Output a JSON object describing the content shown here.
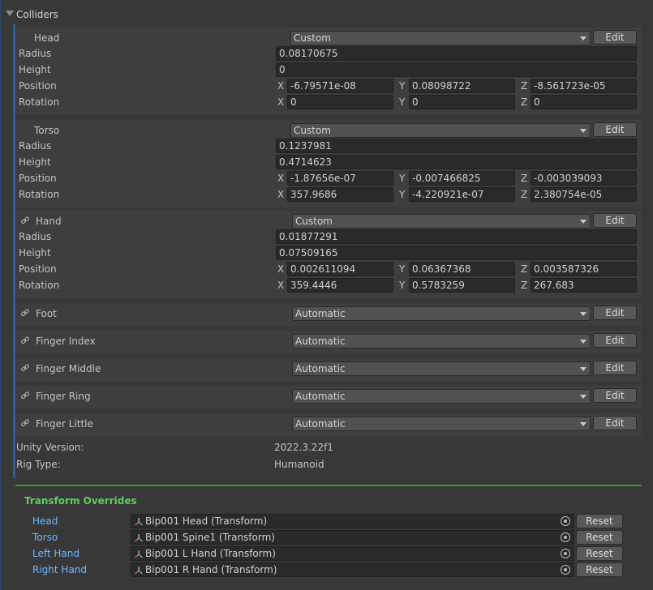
{
  "section": {
    "title": "Colliders"
  },
  "labels": {
    "radius": "Radius",
    "height": "Height",
    "position": "Position",
    "rotation": "Rotation",
    "x": "X",
    "y": "Y",
    "z": "Z",
    "edit": "Edit"
  },
  "colliders": [
    {
      "name": "Head",
      "mode": "Custom",
      "linked": false,
      "radius": "0.08170675",
      "height": "0",
      "position": [
        "-6.79571e-08",
        "0.08098722",
        "-8.561723e-05"
      ],
      "rotation": [
        "0",
        "0",
        "0"
      ]
    },
    {
      "name": "Torso",
      "mode": "Custom",
      "linked": false,
      "radius": "0.1237981",
      "height": "0.4714623",
      "position": [
        "-1.87656e-07",
        "-0.007466825",
        "-0.003039093"
      ],
      "rotation": [
        "357.9686",
        "-4.220921e-07",
        "2.380754e-05"
      ]
    },
    {
      "name": "Hand",
      "mode": "Custom",
      "linked": true,
      "radius": "0.01877291",
      "height": "0.07509165",
      "position": [
        "0.002611094",
        "0.06367368",
        "0.003587326"
      ],
      "rotation": [
        "359.4446",
        "0.5783259",
        "267.683"
      ]
    },
    {
      "name": "Foot",
      "mode": "Automatic",
      "linked": true
    },
    {
      "name": "Finger Index",
      "mode": "Automatic",
      "linked": true
    },
    {
      "name": "Finger Middle",
      "mode": "Automatic",
      "linked": true
    },
    {
      "name": "Finger Ring",
      "mode": "Automatic",
      "linked": true
    },
    {
      "name": "Finger Little",
      "mode": "Automatic",
      "linked": true
    }
  ],
  "info": {
    "unity_version_label": "Unity Version:",
    "unity_version": "2022.3.22f1",
    "rig_type_label": "Rig Type:",
    "rig_type": "Humanoid"
  },
  "overrides": {
    "title": "Transform Overrides",
    "reset_label": "Reset",
    "rows": [
      {
        "label": "Head",
        "object": "Bip001 Head (Transform)"
      },
      {
        "label": "Torso",
        "object": "Bip001 Spine1 (Transform)"
      },
      {
        "label": "Left Hand",
        "object": "Bip001 L Hand (Transform)"
      },
      {
        "label": "Right Hand",
        "object": "Bip001 R Hand (Transform)"
      }
    ]
  },
  "colors": {
    "accent": "#2d5da0",
    "override_title": "#5ad35a",
    "override_label": "#6fb8ff",
    "divider": "#3a9a3a"
  }
}
